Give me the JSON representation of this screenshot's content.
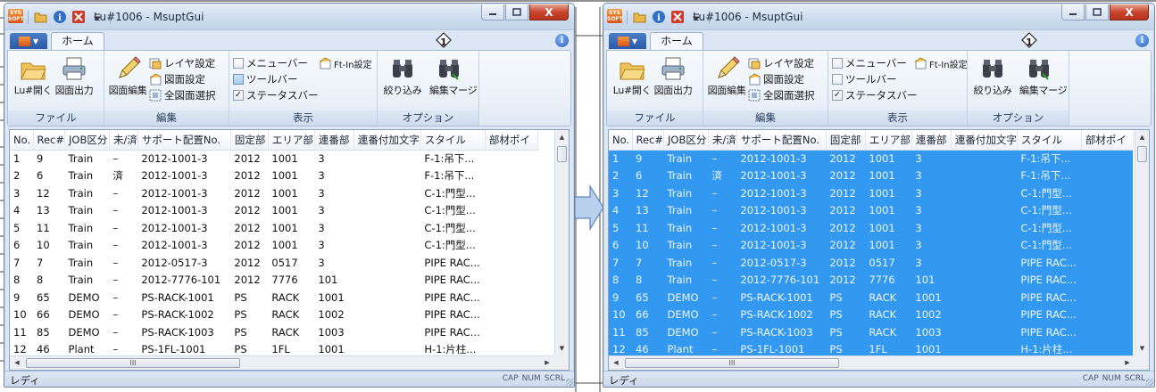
{
  "colors": {
    "selection": "#3399f0",
    "ribbon_group_label": "#2a3d5a",
    "arrow_fill": "#b9d0ec",
    "arrow_stroke": "#5f86bb"
  },
  "title_bar": {
    "title": "Lu#1006 - MsuptGui",
    "app_icon_text": "SYS SOFT",
    "qat_separator": "|",
    "minimize_icon": "minimize-icon",
    "maximize_icon": "maximize-icon",
    "close_icon": "close-icon",
    "close_glyph": "X"
  },
  "ribbon": {
    "home_tab": "ホーム",
    "marker": "1",
    "help_glyph": "i",
    "groups": {
      "file": {
        "label": "ファイル",
        "open_lu": "Lu#開く",
        "drawing_output": "図面出力"
      },
      "edit": {
        "label": "編集",
        "drawing_edit": "図面編集",
        "layer_settings": "レイヤ設定",
        "drawing_settings": "図面設定",
        "select_all_drawings": "全図面選択"
      },
      "display": {
        "label": "表示",
        "menu_bar": "メニューバー",
        "tool_bar": "ツールバー",
        "status_bar": "ステータスバー",
        "ft_in_settings": "Ft-In設定"
      },
      "options": {
        "label": "オプション",
        "filter": "絞り込み",
        "edit_merge": "編集マージ"
      }
    }
  },
  "grid": {
    "columns": [
      "No.",
      "Rec#",
      "JOB区分",
      "未/済",
      "サポート配置No.",
      "固定部",
      "エリア部",
      "連番部",
      "連番付加文字",
      "スタイル",
      "部材ポイ"
    ],
    "rows": [
      [
        "1",
        "9",
        "Train",
        "–",
        "2012-1001-3",
        "2012",
        "1001",
        "3",
        "",
        "F-1:吊下...",
        ""
      ],
      [
        "2",
        "6",
        "Train",
        "済",
        "2012-1001-3",
        "2012",
        "1001",
        "3",
        "",
        "F-1:吊下...",
        ""
      ],
      [
        "3",
        "12",
        "Train",
        "–",
        "2012-1001-3",
        "2012",
        "1001",
        "3",
        "",
        "C-1:門型...",
        ""
      ],
      [
        "4",
        "13",
        "Train",
        "–",
        "2012-1001-3",
        "2012",
        "1001",
        "3",
        "",
        "C-1:門型...",
        ""
      ],
      [
        "5",
        "11",
        "Train",
        "–",
        "2012-1001-3",
        "2012",
        "1001",
        "3",
        "",
        "C-1:門型...",
        ""
      ],
      [
        "6",
        "10",
        "Train",
        "–",
        "2012-1001-3",
        "2012",
        "1001",
        "3",
        "",
        "C-1:門型...",
        ""
      ],
      [
        "7",
        "7",
        "Train",
        "–",
        "2012-0517-3",
        "2012",
        "0517",
        "3",
        "",
        "PIPE RAC...",
        ""
      ],
      [
        "8",
        "8",
        "Train",
        "–",
        "2012-7776-101",
        "2012",
        "7776",
        "101",
        "",
        "PIPE RAC...",
        ""
      ],
      [
        "9",
        "65",
        "DEMO",
        "–",
        "PS-RACK-1001",
        "PS",
        "RACK",
        "1001",
        "",
        "PIPE RAC...",
        ""
      ],
      [
        "10",
        "66",
        "DEMO",
        "–",
        "PS-RACK-1002",
        "PS",
        "RACK",
        "1002",
        "",
        "PIPE RAC...",
        ""
      ],
      [
        "11",
        "85",
        "DEMO",
        "–",
        "PS-RACK-1003",
        "PS",
        "RACK",
        "1003",
        "",
        "PIPE RAC...",
        ""
      ],
      [
        "12",
        "46",
        "Plant",
        "–",
        "PS-1FL-1001",
        "PS",
        "1FL",
        "1001",
        "",
        "H-1:片柱...",
        ""
      ]
    ],
    "hscroll_thumb_grip": "III"
  },
  "status_bar": {
    "text": "レディ",
    "indicators": [
      "CAP",
      "NUM",
      "SCRL"
    ]
  },
  "transition_arrow_icon": "right-arrow-icon"
}
